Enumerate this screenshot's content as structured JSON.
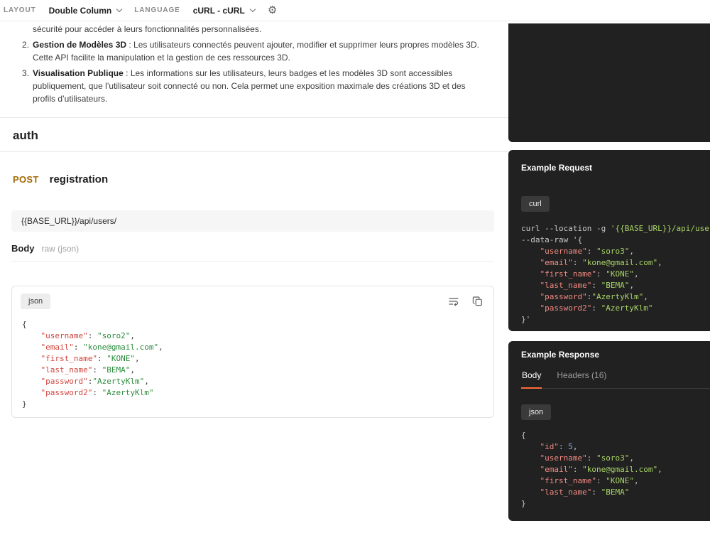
{
  "topbar": {
    "layout_label": "LAYOUT",
    "layout_value": "Double Column",
    "language_label": "LANGUAGE",
    "language_value": "cURL - cURL",
    "settings_icon_glyph": "⚙"
  },
  "doc": {
    "intro_fragment": "sécurité pour accéder à leurs fonctionnalités personnalisées.",
    "list_items": [
      {
        "num": "2.",
        "title": "Gestion de Modèles 3D",
        "text": " : Les utilisateurs connectés peuvent ajouter, modifier et supprimer leurs propres modèles 3D. Cette API facilite la manipulation et la gestion de ces ressources 3D."
      },
      {
        "num": "3.",
        "title": "Visualisation Publique",
        "text": " : Les informations sur les utilisateurs, leurs badges et les modèles 3D sont accessibles publiquement, que l’utilisateur soit connecté ou non. Cela permet une exposition maximale des créations 3D et des profils d’utilisateurs."
      }
    ],
    "section_title": "auth"
  },
  "request": {
    "method": "POST",
    "name": "registration",
    "url": "{{BASE_URL}}/api/users/",
    "body_label": "Body",
    "body_mode": "raw (json)",
    "code_lang": "json",
    "code_lines": [
      [
        [
          "p",
          "{"
        ]
      ],
      [
        [
          "w",
          "    "
        ],
        [
          "k",
          "\"username\""
        ],
        [
          "p",
          ": "
        ],
        [
          "s",
          "\"soro2\""
        ],
        [
          "p",
          ","
        ]
      ],
      [
        [
          "w",
          "    "
        ],
        [
          "k",
          "\"email\""
        ],
        [
          "p",
          ": "
        ],
        [
          "s",
          "\"kone@gmail.com\""
        ],
        [
          "p",
          ","
        ]
      ],
      [
        [
          "w",
          "    "
        ],
        [
          "k",
          "\"first_name\""
        ],
        [
          "p",
          ": "
        ],
        [
          "s",
          "\"KONE\""
        ],
        [
          "p",
          ","
        ]
      ],
      [
        [
          "w",
          "    "
        ],
        [
          "k",
          "\"last_name\""
        ],
        [
          "p",
          ": "
        ],
        [
          "s",
          "\"BEMA\""
        ],
        [
          "p",
          ","
        ]
      ],
      [
        [
          "w",
          "    "
        ],
        [
          "k",
          "\"password\""
        ],
        [
          "p",
          ":"
        ],
        [
          "s",
          "\"AzertyKlm\""
        ],
        [
          "p",
          ","
        ]
      ],
      [
        [
          "w",
          "    "
        ],
        [
          "k",
          "\"password2\""
        ],
        [
          "p",
          ": "
        ],
        [
          "s",
          "\"AzertyKlm\""
        ]
      ],
      [
        [
          "p",
          "}"
        ]
      ]
    ]
  },
  "example_request": {
    "title": "Example Request",
    "lang": "curl",
    "lines": [
      [
        [
          "d",
          "curl --location -g "
        ],
        [
          "s",
          "'{{BASE_URL}}/api/users/'"
        ],
        [
          "d",
          " \\"
        ]
      ],
      [
        [
          "d",
          "--data-raw '"
        ],
        [
          "p",
          "{"
        ]
      ],
      [
        [
          "w",
          "    "
        ],
        [
          "k",
          "\"username\""
        ],
        [
          "p",
          ": "
        ],
        [
          "s",
          "\"soro3\""
        ],
        [
          "p",
          ","
        ]
      ],
      [
        [
          "w",
          "    "
        ],
        [
          "k",
          "\"email\""
        ],
        [
          "p",
          ": "
        ],
        [
          "s",
          "\"kone@gmail.com\""
        ],
        [
          "p",
          ","
        ]
      ],
      [
        [
          "w",
          "    "
        ],
        [
          "k",
          "\"first_name\""
        ],
        [
          "p",
          ": "
        ],
        [
          "s",
          "\"KONE\""
        ],
        [
          "p",
          ","
        ]
      ],
      [
        [
          "w",
          "    "
        ],
        [
          "k",
          "\"last_name\""
        ],
        [
          "p",
          ": "
        ],
        [
          "s",
          "\"BEMA\""
        ],
        [
          "p",
          ","
        ]
      ],
      [
        [
          "w",
          "    "
        ],
        [
          "k",
          "\"password\""
        ],
        [
          "p",
          ":"
        ],
        [
          "s",
          "\"AzertyKlm\""
        ],
        [
          "p",
          ","
        ]
      ],
      [
        [
          "w",
          "    "
        ],
        [
          "k",
          "\"password2\""
        ],
        [
          "p",
          ": "
        ],
        [
          "s",
          "\"AzertyKlm\""
        ]
      ],
      [
        [
          "p",
          "}'"
        ]
      ]
    ]
  },
  "example_response": {
    "title": "Example Response",
    "tabs": [
      "Body",
      "Headers (16)"
    ],
    "active_tab": "Body",
    "lang": "json",
    "lines": [
      [
        [
          "p",
          "{"
        ]
      ],
      [
        [
          "w",
          "    "
        ],
        [
          "k",
          "\"id\""
        ],
        [
          "p",
          ": "
        ],
        [
          "n",
          "5"
        ],
        [
          "p",
          ","
        ]
      ],
      [
        [
          "w",
          "    "
        ],
        [
          "k",
          "\"username\""
        ],
        [
          "p",
          ": "
        ],
        [
          "s",
          "\"soro3\""
        ],
        [
          "p",
          ","
        ]
      ],
      [
        [
          "w",
          "    "
        ],
        [
          "k",
          "\"email\""
        ],
        [
          "p",
          ": "
        ],
        [
          "s",
          "\"kone@gmail.com\""
        ],
        [
          "p",
          ","
        ]
      ],
      [
        [
          "w",
          "    "
        ],
        [
          "k",
          "\"first_name\""
        ],
        [
          "p",
          ": "
        ],
        [
          "s",
          "\"KONE\""
        ],
        [
          "p",
          ","
        ]
      ],
      [
        [
          "w",
          "    "
        ],
        [
          "k",
          "\"last_name\""
        ],
        [
          "p",
          ": "
        ],
        [
          "s",
          "\"BEMA\""
        ]
      ],
      [
        [
          "p",
          "}"
        ]
      ]
    ]
  },
  "colors": {
    "method_post": "#a36a03",
    "accent_orange": "#ff6c37",
    "panel_dark": "#212121",
    "code_key_light": "#d0453e",
    "code_string_light": "#2a8c3c",
    "code_key_dark": "#f28b82",
    "code_string_dark": "#a8d468",
    "code_number_dark": "#7fb4f2"
  }
}
